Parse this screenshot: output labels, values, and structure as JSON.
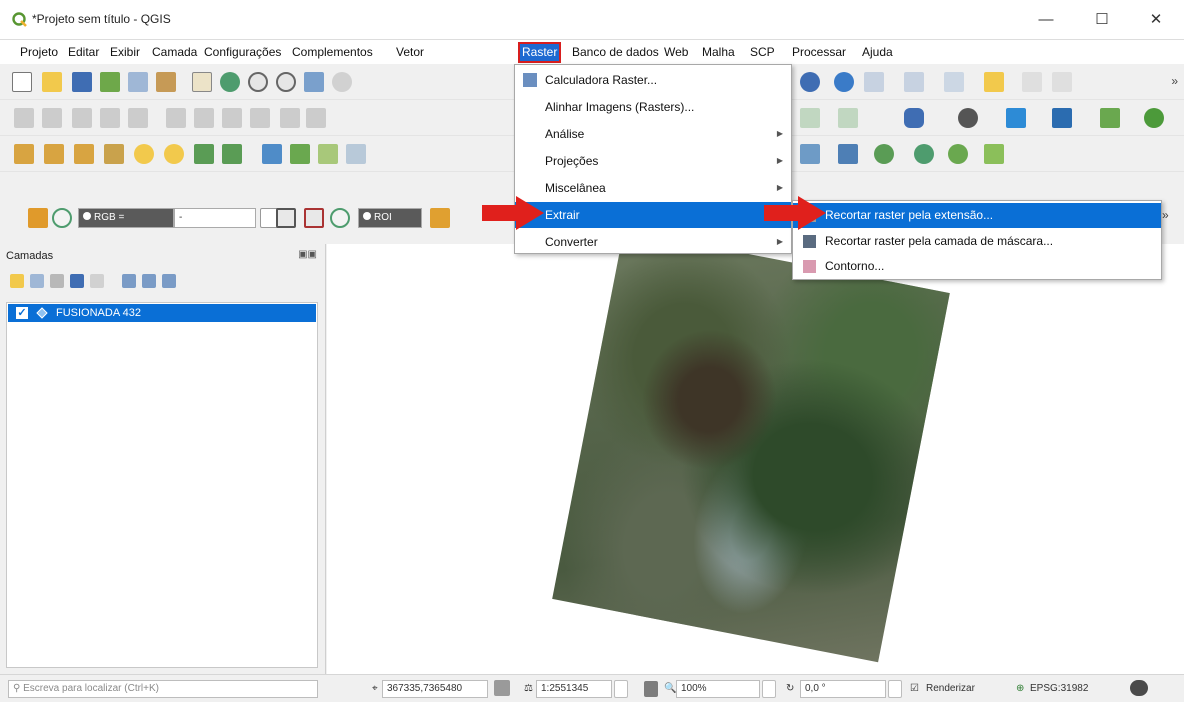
{
  "window": {
    "title": "*Projeto sem título - QGIS",
    "minimize": "—",
    "maximize": "☐",
    "close": "✕"
  },
  "menubar": {
    "items": [
      "Projeto",
      "Editar",
      "Exibir",
      "Camada",
      "Configurações",
      "Complementos",
      "Vetor",
      "Raster",
      "Banco de dados",
      "Web",
      "Malha",
      "SCP",
      "Processar",
      "Ajuda"
    ],
    "active": "Raster"
  },
  "toolbar_scp": {
    "rgb_label": "RGB =",
    "rgb_value": "-",
    "roi_label": "ROI"
  },
  "raster_menu": {
    "items": [
      {
        "label": "Calculadora Raster...",
        "has_submenu": false
      },
      {
        "label": "Alinhar Imagens (Rasters)...",
        "has_submenu": false
      },
      {
        "label": "Análise",
        "has_submenu": true
      },
      {
        "label": "Projeções",
        "has_submenu": true
      },
      {
        "label": "Miscelânea",
        "has_submenu": true
      },
      {
        "label": "Extrair",
        "has_submenu": true,
        "highlighted": true
      },
      {
        "label": "Converter",
        "has_submenu": true
      }
    ]
  },
  "extrair_submenu": {
    "items": [
      {
        "label": "Recortar raster pela extensão...",
        "highlighted": true,
        "icon": "clip-extent-icon"
      },
      {
        "label": "Recortar raster pela camada de máscara...",
        "highlighted": false,
        "icon": "clip-mask-icon"
      },
      {
        "label": "Contorno...",
        "highlighted": false,
        "icon": "contour-icon"
      }
    ]
  },
  "layers_panel": {
    "title": "Camadas",
    "layers": [
      {
        "name": "FUSIONADA 432",
        "checked": true,
        "selected": true
      }
    ]
  },
  "statusbar": {
    "locator_placeholder": "Escreva para localizar (Ctrl+K)",
    "coordinate": "367335,7365480",
    "scale": "1:2551345",
    "magnifier": "100%",
    "rotation": "0,0 °",
    "render_label": "Renderizar",
    "crs": "EPSG:31982"
  },
  "colors": {
    "accent": "#0a6fd6",
    "highlight_border": "#d81e1e",
    "arrow": "#e0201c"
  }
}
